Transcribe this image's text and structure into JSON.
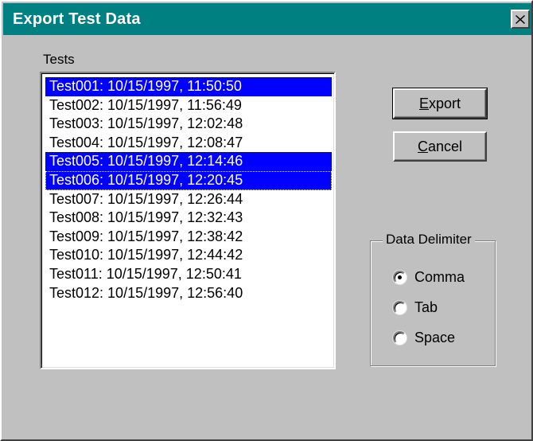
{
  "window": {
    "title": "Export Test Data",
    "close_icon": "close-icon"
  },
  "tests": {
    "label": "Tests",
    "items": [
      {
        "text": "Test001: 10/15/1997, 11:50:50",
        "selected": true,
        "focused": false
      },
      {
        "text": "Test002: 10/15/1997, 11:56:49",
        "selected": false,
        "focused": false
      },
      {
        "text": "Test003: 10/15/1997, 12:02:48",
        "selected": false,
        "focused": false
      },
      {
        "text": "Test004: 10/15/1997, 12:08:47",
        "selected": false,
        "focused": false
      },
      {
        "text": "Test005: 10/15/1997, 12:14:46",
        "selected": true,
        "focused": false
      },
      {
        "text": "Test006: 10/15/1997, 12:20:45",
        "selected": true,
        "focused": true
      },
      {
        "text": "Test007: 10/15/1997, 12:26:44",
        "selected": false,
        "focused": false
      },
      {
        "text": "Test008: 10/15/1997, 12:32:43",
        "selected": false,
        "focused": false
      },
      {
        "text": "Test009: 10/15/1997, 12:38:42",
        "selected": false,
        "focused": false
      },
      {
        "text": "Test010: 10/15/1997, 12:44:42",
        "selected": false,
        "focused": false
      },
      {
        "text": "Test011: 10/15/1997, 12:50:41",
        "selected": false,
        "focused": false
      },
      {
        "text": "Test012: 10/15/1997, 12:56:40",
        "selected": false,
        "focused": false
      }
    ]
  },
  "buttons": {
    "export": {
      "label": "Export",
      "mnemonic_index": 0
    },
    "cancel": {
      "label": "Cancel",
      "mnemonic_index": 0
    }
  },
  "delimiter": {
    "label": "Data Delimiter",
    "options": [
      {
        "label": "Comma",
        "checked": true
      },
      {
        "label": "Tab",
        "checked": false
      },
      {
        "label": "Space",
        "checked": false
      }
    ]
  },
  "colors": {
    "titlebar": "#008080",
    "selection": "#0000ff",
    "face": "#c0c0c0"
  }
}
